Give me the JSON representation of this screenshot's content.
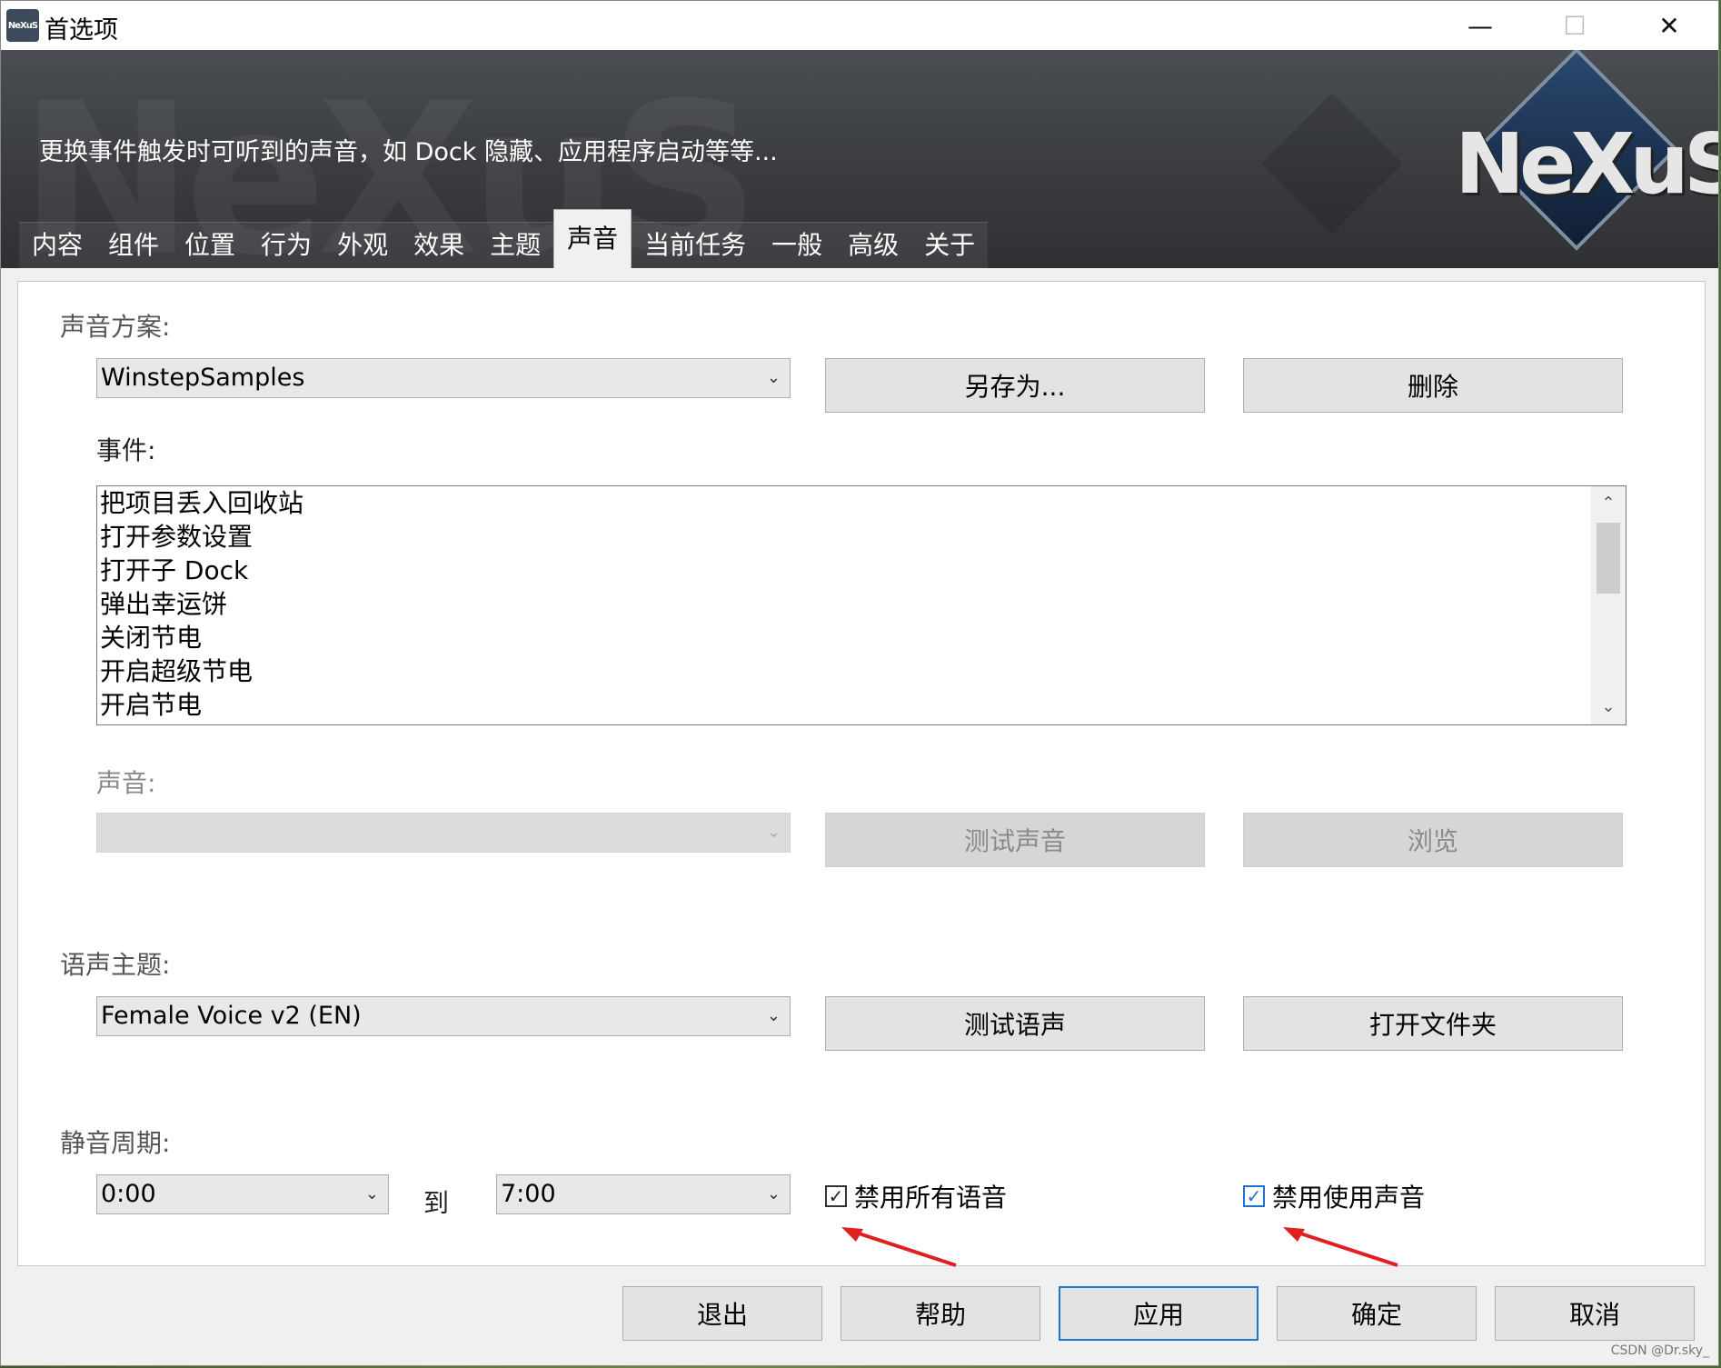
{
  "window": {
    "title": "首选项",
    "icon_text": "NeXuS",
    "controls": {
      "minimize": "—",
      "maximize": "☐",
      "close": "✕"
    }
  },
  "banner": {
    "description": "更换事件触发时可听到的声音，如 Dock 隐藏、应用程序启动等等...",
    "logo_text": "NeXuS",
    "watermark": "NeXuS"
  },
  "tabs": [
    {
      "label": "内容"
    },
    {
      "label": "组件"
    },
    {
      "label": "位置"
    },
    {
      "label": "行为"
    },
    {
      "label": "外观"
    },
    {
      "label": "效果"
    },
    {
      "label": "主题"
    },
    {
      "label": "声音",
      "active": true
    },
    {
      "label": "当前任务"
    },
    {
      "label": "一般"
    },
    {
      "label": "高级"
    },
    {
      "label": "关于"
    }
  ],
  "sound_scheme": {
    "section_label": "声音方案:",
    "selected": "WinstepSamples",
    "save_as_button": "另存为...",
    "delete_button": "删除"
  },
  "events": {
    "label": "事件:",
    "items": [
      "把项目丢入回收站",
      "打开参数设置",
      "打开子 Dock",
      "弹出幸运饼",
      "关闭节电",
      "开启超级节电",
      "开启节电"
    ]
  },
  "sound": {
    "label": "声音:",
    "selected": "",
    "test_button": "测试声音",
    "browse_button": "浏览"
  },
  "voice_theme": {
    "section_label": "语声主题:",
    "selected": "Female Voice v2 (EN)",
    "test_button": "测试语声",
    "open_folder_button": "打开文件夹"
  },
  "mute_period": {
    "section_label": "静音周期:",
    "from": "0:00",
    "to_label": "到",
    "to": "7:00",
    "disable_all_voice_label": "禁用所有语音",
    "disable_all_voice_checked": true,
    "disable_sound_label": "禁用使用声音",
    "disable_sound_checked": true
  },
  "footer": {
    "exit": "退出",
    "help": "帮助",
    "apply": "应用",
    "ok": "确定",
    "cancel": "取消"
  },
  "corner_watermark": "CSDN @Dr.sky_",
  "colors": {
    "accent": "#1f72d1",
    "annotation_arrow": "#e02020",
    "banner_bg": "#3a3c40"
  }
}
